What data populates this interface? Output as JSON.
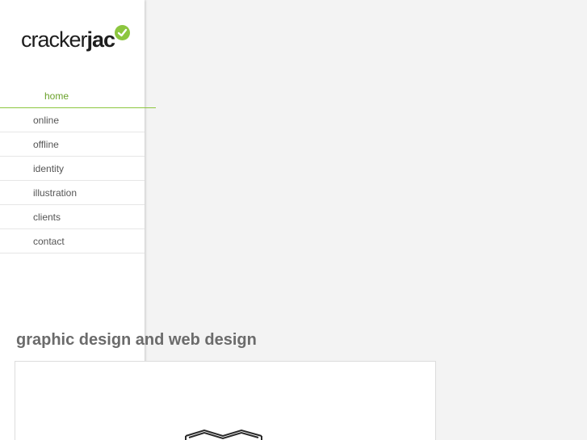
{
  "brand": {
    "name_light": "cracker",
    "name_bold": "jac",
    "accent_color": "#8cc63f",
    "mark_icon": "check-circle-icon"
  },
  "nav": {
    "items": [
      {
        "label": "home",
        "active": true
      },
      {
        "label": "online",
        "active": false
      },
      {
        "label": "offline",
        "active": false
      },
      {
        "label": "identity",
        "active": false
      },
      {
        "label": "illustration",
        "active": false
      },
      {
        "label": "clients",
        "active": false
      },
      {
        "label": "contact",
        "active": false
      }
    ]
  },
  "main": {
    "heading": "graphic design and web design",
    "hero_icon": "cube-logo-icon"
  }
}
